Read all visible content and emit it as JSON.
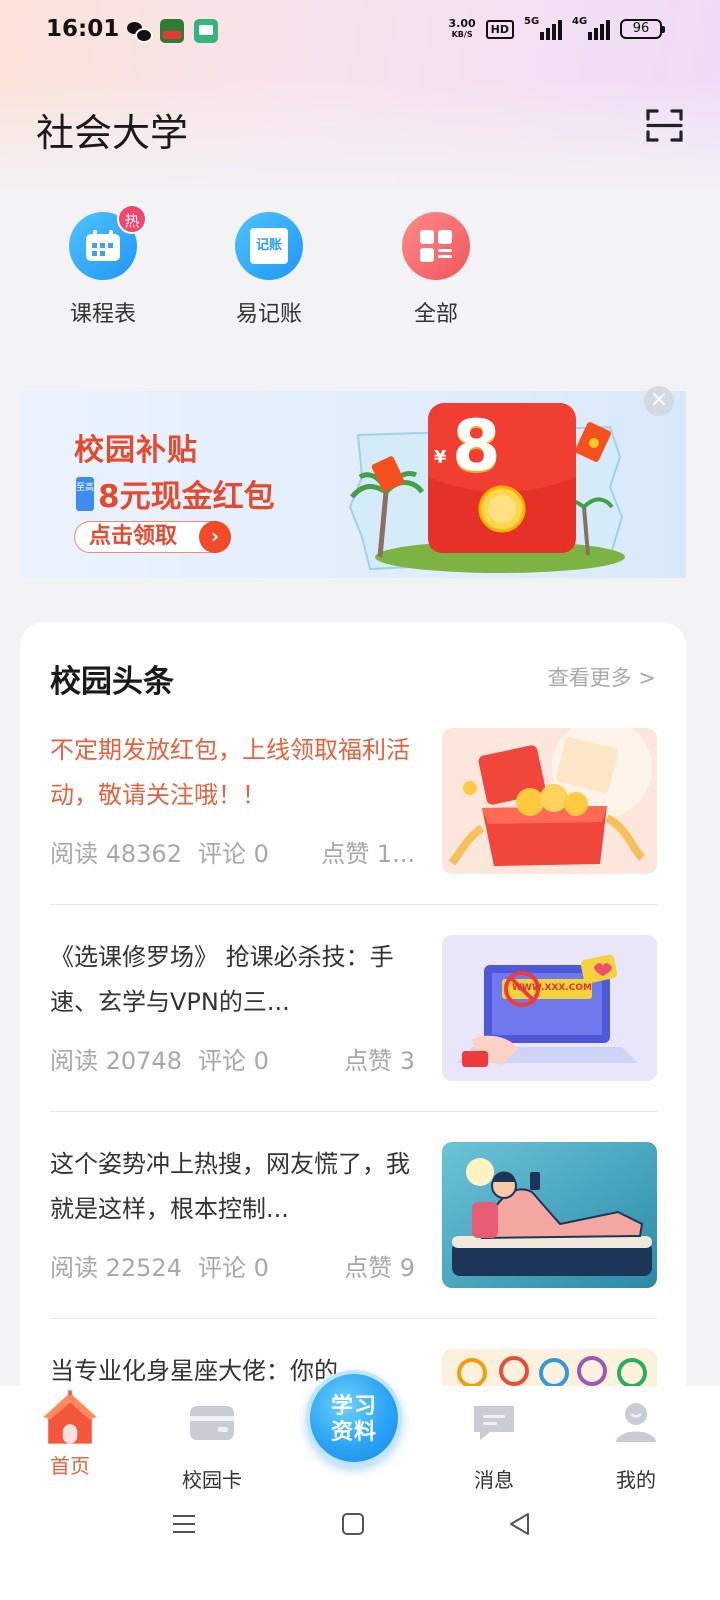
{
  "status_bar": {
    "time": "16:01",
    "net_speed_value": "3.00",
    "net_speed_unit": "KB/S",
    "hd": "HD",
    "sim1": "5G",
    "sim2": "4G",
    "battery": "96"
  },
  "header": {
    "title": "社会大学"
  },
  "quick_apps": [
    {
      "label": "课程表",
      "badge": "热"
    },
    {
      "label": "易记账",
      "icon_text": "记账"
    },
    {
      "label": "全部"
    }
  ],
  "banner": {
    "title": "校园补贴",
    "tag": "至高",
    "subtitle": "8元现金红包",
    "cta": "点击领取",
    "amount": "8",
    "currency": "¥"
  },
  "news": {
    "title": "校园头条",
    "more": "查看更多 >",
    "items": [
      {
        "text": "不定期发放红包，上线领取福利活动，敬请关注哦！！",
        "reads": "阅读 48362",
        "comments": "评论 0",
        "likes": "点赞 1...",
        "highlight": true
      },
      {
        "text": "《选课修罗场》 抢课必杀技：手速、玄学与VPN的三...",
        "reads": "阅读 20748",
        "comments": "评论 0",
        "likes": "点赞 3",
        "thumb_text": "WWW.XXX.COM"
      },
      {
        "text": "这个姿势冲上热搜，网友慌了，我就是这样，根本控制...",
        "reads": "阅读 22524",
        "comments": "评论 0",
        "likes": "点赞 9"
      },
      {
        "text": "当专业化身星座大佬：你的",
        "reads": "",
        "comments": "",
        "likes": ""
      }
    ]
  },
  "bottom_nav": {
    "home": "首页",
    "card": "校园卡",
    "study": "学习资料",
    "messages": "消息",
    "mine": "我的"
  },
  "colors": {
    "accent": "#e8603c",
    "brand_blue": "#2aa4f4"
  }
}
